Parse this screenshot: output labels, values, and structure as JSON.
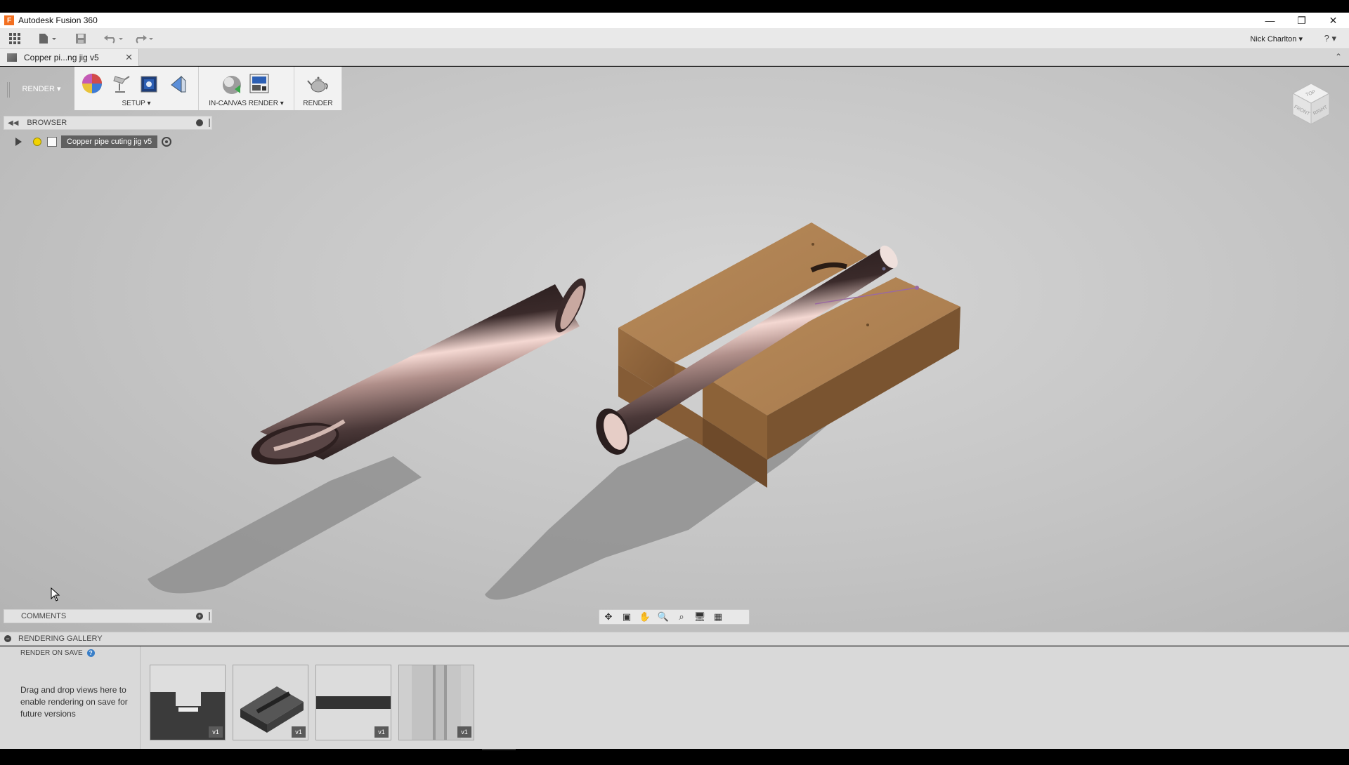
{
  "window": {
    "title": "Autodesk Fusion 360",
    "logo_letter": "F"
  },
  "window_controls": {
    "minimize": "—",
    "restore": "❐",
    "close": "✕"
  },
  "quick_access": {
    "user_name": "Nick Charlton ▾",
    "help": "? ▾"
  },
  "document_tab": {
    "title": "Copper pi...ng jig v5",
    "close": "✕"
  },
  "ribbon": {
    "workspace_label": "RENDER ▾",
    "setup_label": "SETUP ▾",
    "in_canvas_render_label": "IN-CANVAS RENDER ▾",
    "render_label": "RENDER"
  },
  "browser": {
    "header_label": "BROWSER",
    "root_component": "Copper pipe cuting jig v5"
  },
  "comments": {
    "header_label": "COMMENTS",
    "add": "+"
  },
  "viewcube": {
    "top": "TOP",
    "front": "FRONT",
    "right": "RIGHT"
  },
  "rendering_gallery": {
    "header_label": "RENDERING GALLERY",
    "collapse": "−",
    "render_on_save": "RENDER ON SAVE",
    "help": "?",
    "drag_hint": "Drag and drop views here to enable rendering on save for future versions",
    "thumbnails": [
      {
        "version": "v1"
      },
      {
        "version": "v1"
      },
      {
        "version": "v1"
      },
      {
        "version": "v1"
      }
    ]
  }
}
